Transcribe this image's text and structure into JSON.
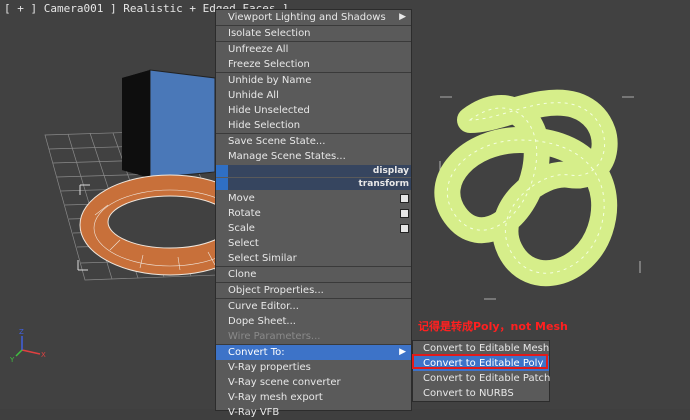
{
  "viewport": {
    "label": "[ + ] Camera001 ] Realistic + Edged Faces ]"
  },
  "quad_menu": {
    "items_top": [
      {
        "label": "Viewport Lighting and Shadows",
        "submenu": true
      },
      {
        "label": "Isolate Selection"
      },
      {
        "label": "Unfreeze All"
      },
      {
        "label": "Freeze Selection"
      },
      {
        "label": "Unhide by Name"
      },
      {
        "label": "Unhide All"
      },
      {
        "label": "Hide Unselected"
      },
      {
        "label": "Hide Selection"
      },
      {
        "label": "Save Scene State..."
      },
      {
        "label": "Manage Scene States..."
      }
    ],
    "display_header": "display",
    "transform_header": "transform",
    "items_transform": [
      {
        "label": "Move",
        "option": true
      },
      {
        "label": "Rotate",
        "option": true
      },
      {
        "label": "Scale",
        "option": true
      },
      {
        "label": "Select"
      },
      {
        "label": "Select Similar"
      },
      {
        "label": "Clone"
      },
      {
        "label": "Object Properties..."
      },
      {
        "label": "Curve Editor..."
      },
      {
        "label": "Dope Sheet..."
      },
      {
        "label": "Wire Parameters...",
        "disabled": true
      },
      {
        "label": "Convert To:",
        "submenu": true,
        "highlighted": true
      },
      {
        "label": "V-Ray properties"
      },
      {
        "label": "V-Ray scene converter"
      },
      {
        "label": "V-Ray mesh export"
      },
      {
        "label": "V-Ray VFB"
      }
    ]
  },
  "convert_submenu": [
    {
      "label": "Convert to Editable Mesh"
    },
    {
      "label": "Convert to Editable Poly",
      "highlighted": true
    },
    {
      "label": "Convert to Editable Patch"
    },
    {
      "label": "Convert to NURBS"
    }
  ],
  "annotation": "记得是转成Poly，not Mesh",
  "axis": {
    "x": "X",
    "y": "Y",
    "z": "Z"
  },
  "colors": {
    "menu_bg": "#5a5a5a",
    "highlight": "#3d73c8",
    "annotation": "#ff2020",
    "box": "#4a78b8",
    "torus": "#c8703a",
    "knot": "#d6ee8a"
  }
}
